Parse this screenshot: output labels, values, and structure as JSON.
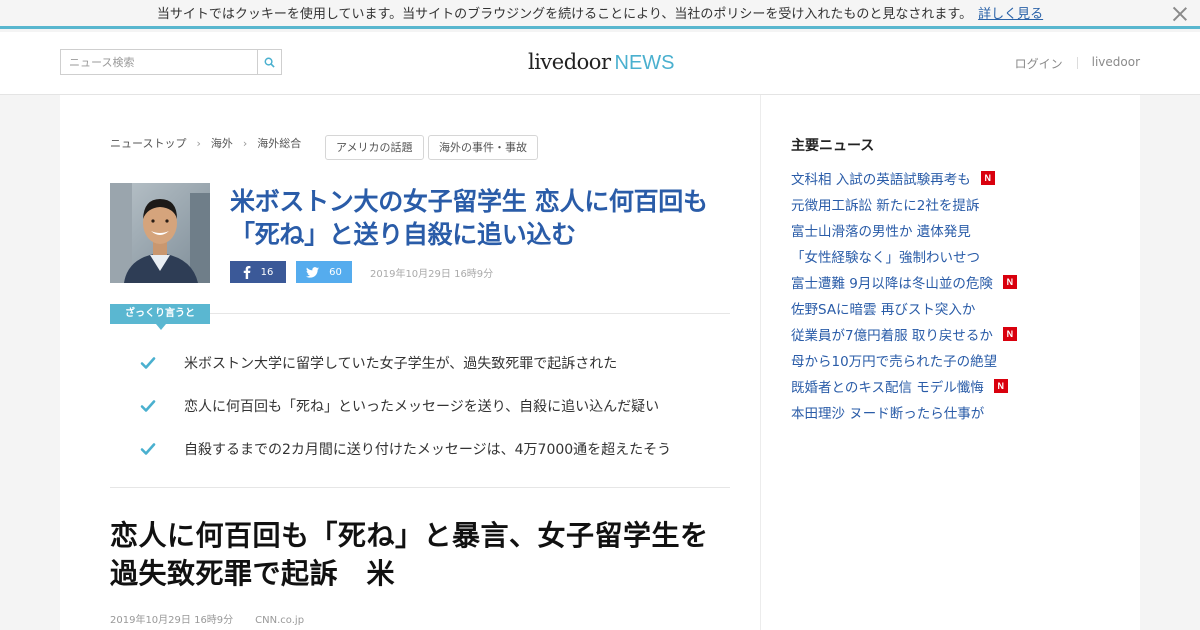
{
  "cookie_bar": {
    "message": "当サイトではクッキーを使用しています。当サイトのブラウジングを続けることにより、当社のポリシーを受け入れたものと見なされます。",
    "link_label": "詳しく見る"
  },
  "header": {
    "search_placeholder": "ニュース検索",
    "logo_main": "livedoor",
    "logo_news": "NEWS",
    "nav": [
      "ログイン",
      "livedoor"
    ]
  },
  "breadcrumb": [
    "ニューストップ",
    "海外",
    "海外総合"
  ],
  "tags": [
    "アメリカの話題",
    "海外の事件・事故"
  ],
  "article": {
    "headline": "米ボストン大の女子留学生 恋人に何百回も「死ね」と送り自殺に追い込む",
    "facebook_count": "16",
    "twitter_count": "60",
    "date": "2019年10月29日 16時9分",
    "summary_label": "ざっくり言うと",
    "summary": [
      "米ボストン大学に留学していた女子学生が、過失致死罪で起訴された",
      "恋人に何百回も「死ね」といったメッセージを送り、自殺に追い込んだ疑い",
      "自殺するまでの2カ月間に送り付けたメッセージは、4万7000通を超えたそう"
    ],
    "title": "恋人に何百回も「死ね」と暴言、女子留学生を過失致死罪で起訴　米",
    "meta_date": "2019年10月29日 16時9分",
    "source": "CNN.co.jp"
  },
  "sidebar": {
    "title": "主要ニュース",
    "news": [
      {
        "text": "文科相 入試の英語試験再考も",
        "is_new": true
      },
      {
        "text": "元徴用工訴訟 新たに2社を提訴",
        "is_new": false
      },
      {
        "text": "富士山滑落の男性か 遺体発見",
        "is_new": false
      },
      {
        "text": "「女性経験なく」強制わいせつ",
        "is_new": false
      },
      {
        "text": "富士遭難 9月以降は冬山並の危険",
        "is_new": true
      },
      {
        "text": "佐野SAに暗雲 再びスト突入か",
        "is_new": false
      },
      {
        "text": "従業員が7億円着服 取り戻せるか",
        "is_new": true
      },
      {
        "text": "母から10万円で売られた子の絶望",
        "is_new": false
      },
      {
        "text": "既婚者とのキス配信 モデル懺悔",
        "is_new": true
      },
      {
        "text": "本田理沙 ヌード断ったら仕事が",
        "is_new": false
      }
    ],
    "new_badge": "N"
  },
  "colors": {
    "accent": "#59b7cf",
    "link": "#2a5ca8",
    "facebook": "#3b5998",
    "twitter": "#55acee",
    "new_badge": "#d9000d"
  }
}
